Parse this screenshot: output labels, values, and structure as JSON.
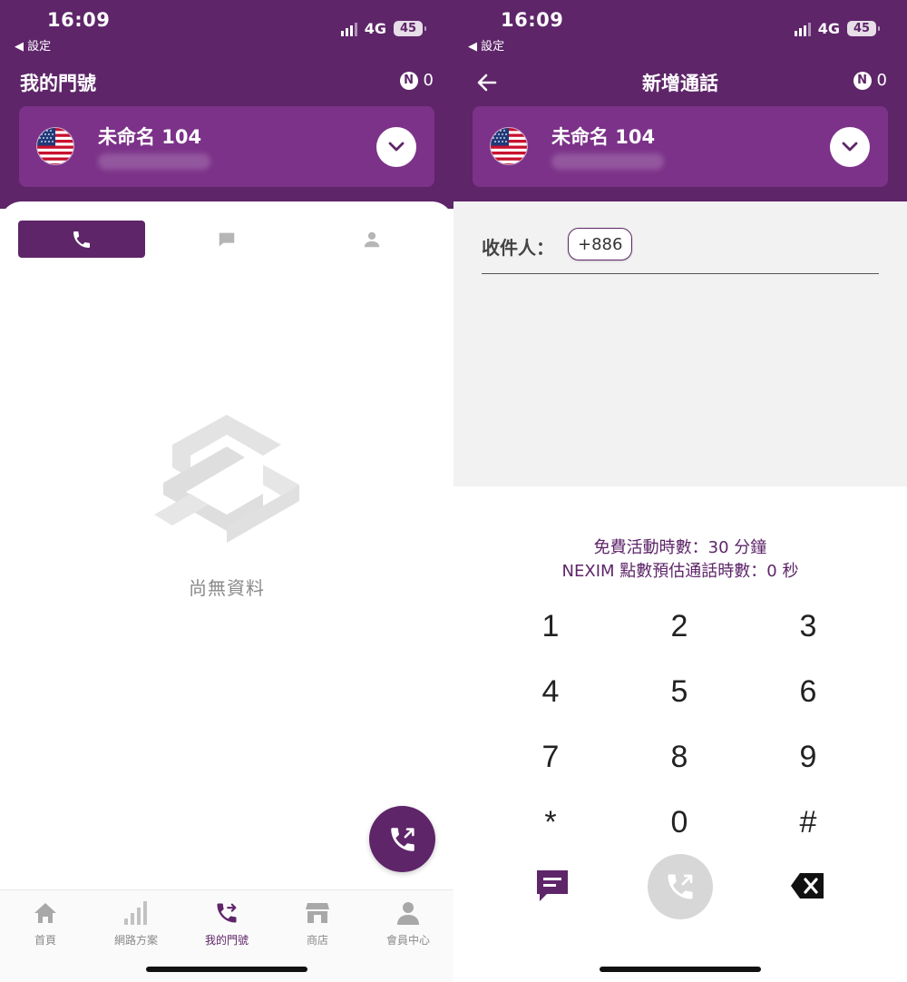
{
  "colors": {
    "brand_purple": "#5e2569",
    "card_purple": "#7c3289",
    "empty_gray": "#e0e0e0",
    "recipient_bg": "#f2f2f2"
  },
  "status_bar": {
    "time": "16:09",
    "back_label": "◀ 設定",
    "network": "4G",
    "battery": "45"
  },
  "left_screen": {
    "title": "我的門號",
    "n_points": "0",
    "number_card": {
      "name": "未命名 104"
    },
    "tabs": [
      {
        "icon": "phone-icon",
        "active": true
      },
      {
        "icon": "message-icon",
        "active": false
      },
      {
        "icon": "person-icon",
        "active": false
      }
    ],
    "empty_text": "尚無資料",
    "bottom_nav": [
      {
        "label": "首頁",
        "icon": "home-icon",
        "active": false
      },
      {
        "label": "網路方案",
        "icon": "signal-bars-icon",
        "active": false
      },
      {
        "label": "我的門號",
        "icon": "phone-forward-icon",
        "active": true
      },
      {
        "label": "商店",
        "icon": "store-icon",
        "active": false
      },
      {
        "label": "會員中心",
        "icon": "person-icon",
        "active": false
      }
    ]
  },
  "right_screen": {
    "title": "新增通話",
    "n_points": "0",
    "number_card": {
      "name": "未命名 104"
    },
    "recipient_label": "收件人：",
    "recipient_value": "+886",
    "info_line1": "免費活動時數：30 分鐘",
    "info_line2": "NEXIM 點數預估通話時數：0 秒",
    "keypad": [
      "1",
      "2",
      "3",
      "4",
      "5",
      "6",
      "7",
      "8",
      "9",
      "*",
      "0",
      "#"
    ]
  }
}
